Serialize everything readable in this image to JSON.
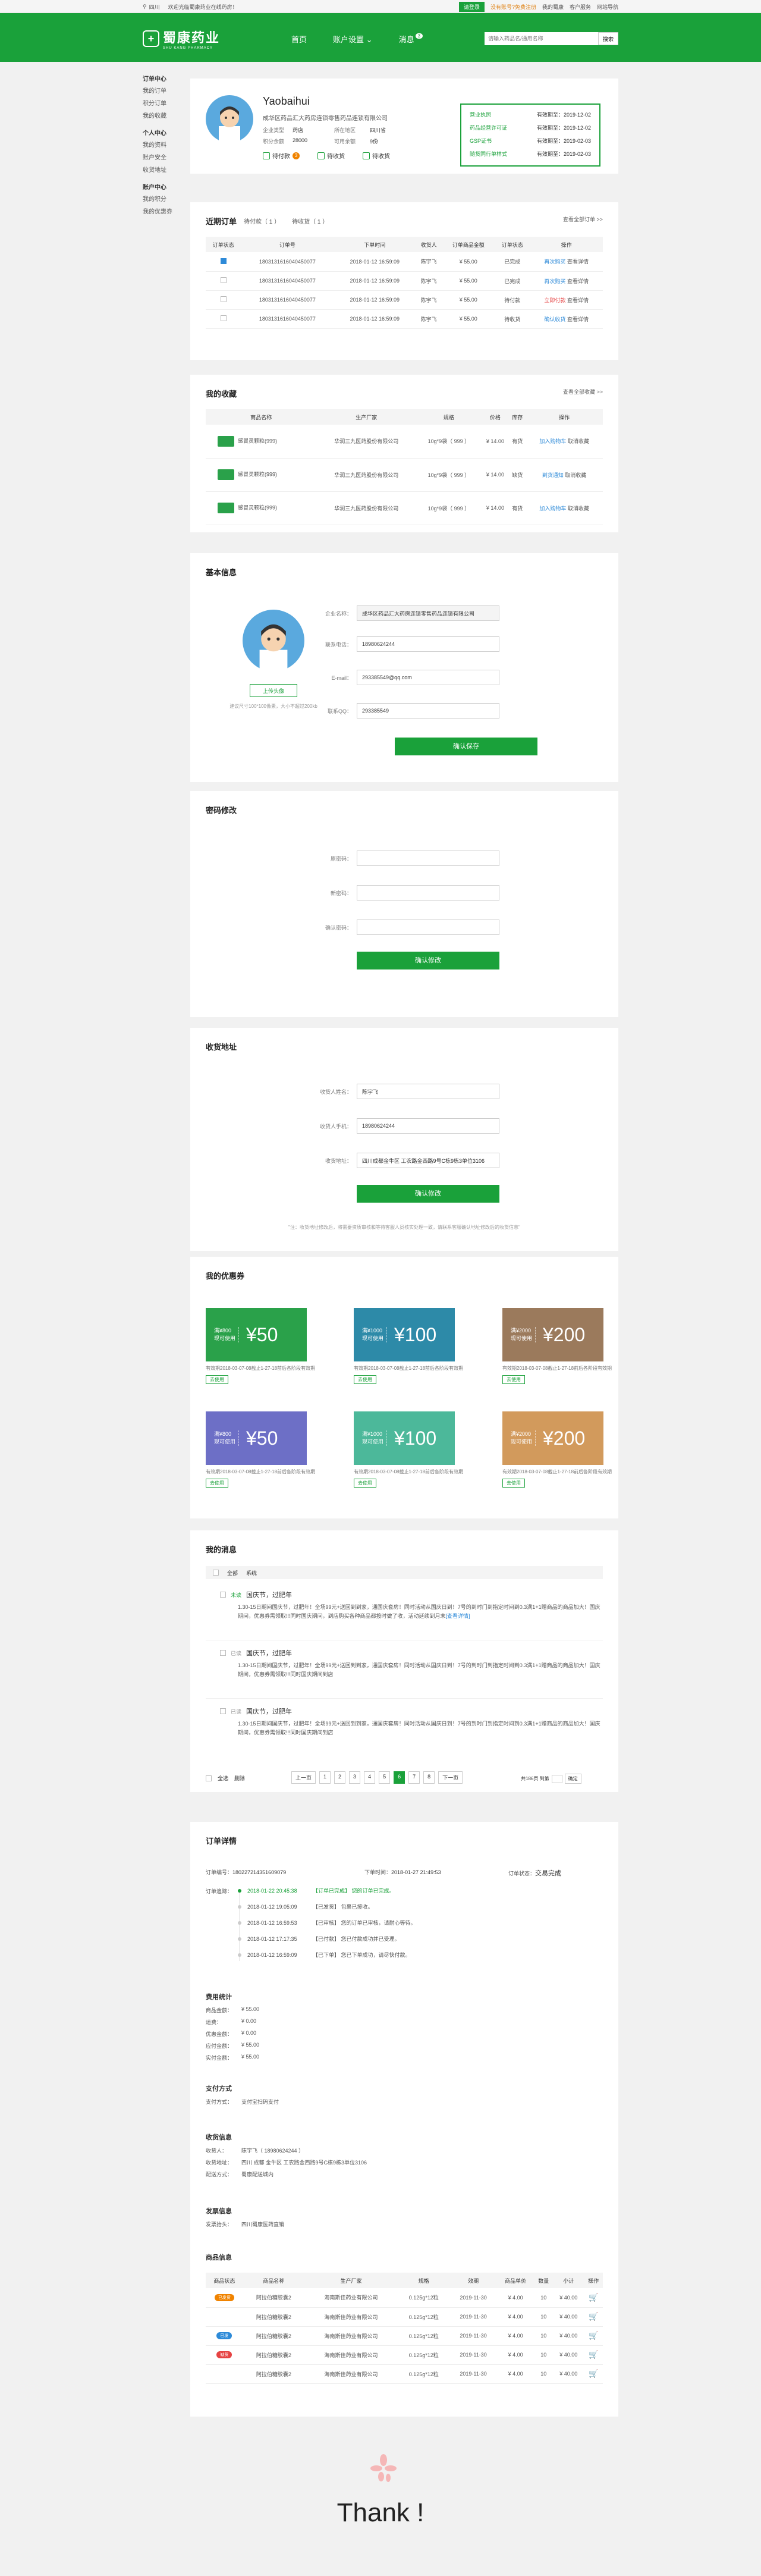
{
  "topbar": {
    "location": "四川",
    "welcome": "欢迎光临蜀康药业在线药房！",
    "login": "请登录",
    "register": "没有账号?免费注册",
    "links": [
      "我的蜀康",
      "客户服务",
      "网站导航"
    ]
  },
  "header": {
    "logo_cn": "蜀康药业",
    "logo_en": "SHU KANG PHARMACY",
    "nav": [
      "首页",
      "账户设置",
      "消息"
    ],
    "msg_badge": "3",
    "search_placeholder": "请输入药品名/通用名称",
    "search_btn": "搜索"
  },
  "sidebar": [
    {
      "title": "订单中心",
      "items": [
        "我的订单",
        "积分订单",
        "我的收藏"
      ]
    },
    {
      "title": "个人中心",
      "items": [
        "我的资料",
        "账户安全",
        "收货地址"
      ]
    },
    {
      "title": "账户中心",
      "items": [
        "我的积分",
        "我的优惠券"
      ]
    }
  ],
  "profile": {
    "name": "Yaobaihui",
    "company": "成华区药品汇大药房连锁零售药品连锁有限公司",
    "fields": [
      [
        "企业类型",
        "药店",
        "所在地区",
        "四川省"
      ],
      [
        "积分余额",
        "28000",
        "可用余额",
        "9份"
      ]
    ],
    "actions": [
      "待付款",
      "待收货",
      "待收货"
    ],
    "pay_badge": "3",
    "stats": [
      [
        "营业执照",
        "有效期至：2019-12-02"
      ],
      [
        "药品经营许可证",
        "有效期至：2019-12-02"
      ],
      [
        "GSP证书",
        "有效期至：2019-02-03"
      ],
      [
        "随货同行单样式",
        "有效期至：2019-02-03"
      ]
    ]
  },
  "recent_orders": {
    "title": "近期订单",
    "tabs": [
      "待付款（ 1 ）",
      "待收货（ 1 ）"
    ],
    "more": "查看全部订单 >>",
    "headers": [
      "订单状态",
      "订单号",
      "下单时间",
      "收货人",
      "订单商品金额",
      "订单状态",
      "操作"
    ],
    "rows": [
      {
        "no": "1803131616040450077",
        "time": "2018-01-12 16:59:09",
        "who": "陈宇飞",
        "amt": "¥ 55.00",
        "status": "已完成",
        "op1": "再次购买",
        "op2": "查看详情"
      },
      {
        "no": "1803131616040450077",
        "time": "2018-01-12 16:59:09",
        "who": "陈宇飞",
        "amt": "¥ 55.00",
        "status": "已完成",
        "op1": "再次购买",
        "op2": "查看详情"
      },
      {
        "no": "1803131616040450077",
        "time": "2018-01-12 16:59:09",
        "who": "陈宇飞",
        "amt": "¥ 55.00",
        "status": "待付款",
        "op1": "立即付款",
        "op2": "查看详情"
      },
      {
        "no": "1803131616040450077",
        "time": "2018-01-12 16:59:09",
        "who": "陈宇飞",
        "amt": "¥ 55.00",
        "status": "待收货",
        "op1": "确认收货",
        "op2": "查看详情"
      }
    ]
  },
  "favorites": {
    "title": "我的收藏",
    "more": "查看全部收藏 >>",
    "headers": [
      "商品名称",
      "生产厂家",
      "规格",
      "价格",
      "库存",
      "操作"
    ],
    "rows": [
      {
        "name": "感冒灵颗粒(999)",
        "maker": "华润三九医药股份有限公司",
        "spec": "10g*9袋（ 999 ）",
        "price": "¥ 14.00",
        "stock": "有货",
        "op1": "加入购物车",
        "op2": "取消收藏"
      },
      {
        "name": "感冒灵颗粒(999)",
        "maker": "华润三九医药股份有限公司",
        "spec": "10g*9袋（ 999 ）",
        "price": "¥ 14.00",
        "stock": "缺货",
        "op1": "到货通知",
        "op2": "取消收藏"
      },
      {
        "name": "感冒灵颗粒(999)",
        "maker": "华润三九医药股份有限公司",
        "spec": "10g*9袋（ 999 ）",
        "price": "¥ 14.00",
        "stock": "有货",
        "op1": "加入购物车",
        "op2": "取消收藏"
      }
    ]
  },
  "basic": {
    "title": "基本信息",
    "upload": "上传头像",
    "tip": "建议尺寸100*100像素，大小不超过200kb",
    "labels": [
      "企业名称：",
      "联系电话：",
      "E-mail：",
      "联系QQ："
    ],
    "values": [
      "成华区药品汇大药房连锁零售药品连锁有限公司",
      "18980624244",
      "293385549@qq.com",
      "293385549"
    ],
    "save": "确认保存"
  },
  "password": {
    "title": "密码修改",
    "labels": [
      "原密码：",
      "新密码：",
      "确认密码："
    ],
    "btn": "确认修改"
  },
  "address": {
    "title": "收货地址",
    "labels": [
      "收货人姓名：",
      "收货人手机：",
      "收货地址："
    ],
    "values": [
      "陈宇飞",
      "18980624244",
      "四川成都金牛区 工农路金西路9号C栋9栋3单位3106"
    ],
    "btn": "确认修改",
    "note": "\"注：收货地址修改后，将需要资质审核和等待客服人员核实处理一致，请联系客服确认地址修改后的收货信息\""
  },
  "coupons": {
    "title": "我的优惠券",
    "items": [
      {
        "cond": "满¥800",
        "type": "现可使用",
        "val": "¥50",
        "color": "#2aa14a"
      },
      {
        "cond": "满¥1000",
        "type": "现可使用",
        "val": "¥100",
        "color": "#2d8aa8"
      },
      {
        "cond": "满¥2000",
        "type": "现可使用",
        "val": "¥200",
        "color": "#9b7a5c"
      },
      {
        "cond": "满¥800",
        "type": "现可使用",
        "val": "¥50",
        "color": "#6d6fc6"
      },
      {
        "cond": "满¥1000",
        "type": "现可使用",
        "val": "¥100",
        "color": "#4cb89a"
      },
      {
        "cond": "满¥2000",
        "type": "现可使用",
        "val": "¥200",
        "color": "#d29a5c"
      }
    ],
    "date": "有效期2018-03-07-08截止1-27-18前后各阶段有效期",
    "use": "去使用"
  },
  "messages": {
    "title": "我的消息",
    "tabs": [
      "全部",
      "系统"
    ],
    "items": [
      {
        "tag": "未读",
        "text": "国庆节，过肥年",
        "body": "1.30-15日期间国庆节，过肥年！全场99元+送回到到家，通国庆套房！同时活动从国庆日到！7号的到时门到指定时间到0.3满1+1赠商品的商品加大！国庆期间，优惠券需领取!!!同时国庆期间，到店购买各种商品都按时做了收，活动延续到月末",
        "link": "[查看详情]"
      },
      {
        "tag": "已读",
        "text": "国庆节，过肥年",
        "body": "1.30-15日期间国庆节，过肥年！全场99元+送回到到家，通国庆套房！同时活动从国庆日到！7号的到时门到指定时间到0.3满1+1赠商品的商品加大！国庆期间，优惠券需领取!!!同时国庆期间到店",
        "link": ""
      },
      {
        "tag": "已读",
        "text": "国庆节，过肥年",
        "body": "1.30-15日期间国庆节，过肥年！全场99元+送回到到家，通国庆套房！同时活动从国庆日到！7号的到时门到指定时间到0.3满1+1赠商品的商品加大！国庆期间，优惠券需领取!!!同时国庆期间到店",
        "link": ""
      }
    ],
    "select_all": "全选",
    "delete": "删除",
    "pages": [
      "上一页",
      "1",
      "2",
      "3",
      "4",
      "5",
      "6",
      "7",
      "8",
      "下一页"
    ],
    "total": "共186页 到第",
    "go": "确定"
  },
  "order_detail": {
    "title": "订单详情",
    "no_label": "订单编号：",
    "no": "180227214351609079",
    "time_label": "下单时间：",
    "time": "2018-01-27 21:49:53",
    "status_label": "订单状态：",
    "status": "交易完成",
    "track_label": "订单追踪：",
    "track": [
      [
        "2018-01-22 20:45:38",
        "【订单已完成】 您的订单已完成。"
      ],
      [
        "2018-01-12 19:05:09",
        "【已发货】 包裹已揽收。"
      ],
      [
        "2018-01-12 16:59:53",
        "【已审核】 您的订单已审核，请耐心等待。"
      ],
      [
        "2018-01-12 17:17:35",
        "【已付款】 您已付款成功并已受理。"
      ],
      [
        "2018-01-12 16:59:09",
        "【已下单】 您已下单成功，请尽快付款。"
      ]
    ],
    "fee_title": "费用统计",
    "fees": [
      [
        "商品金额：",
        "¥ 55.00"
      ],
      [
        "运费：",
        "¥ 0.00"
      ],
      [
        "优惠金额：",
        "¥ 0.00"
      ],
      [
        "应付金额：",
        "¥ 55.00"
      ],
      [
        "实付金额：",
        "¥ 55.00"
      ]
    ],
    "pay_title": "支付方式",
    "pay": [
      [
        "支付方式：",
        "支付宝扫码支付"
      ]
    ],
    "recv_title": "收货信息",
    "recv": [
      [
        "收货人：",
        "陈宇飞（ 18980624244 ）"
      ],
      [
        "收货地址：",
        "四川 成都 金牛区 工农路金西路9号C栋9栋3单位3106"
      ],
      [
        "配送方式：",
        "蜀康配送城内"
      ]
    ],
    "inv_title": "发票信息",
    "inv": [
      [
        "发票抬头：",
        "四川蜀康医药直销"
      ]
    ],
    "goods_title": "商品信息",
    "goods_headers": [
      "商品状态",
      "商品名称",
      "生产厂家",
      "规格",
      "效期",
      "商品单价",
      "数量",
      "小计",
      "操作"
    ],
    "goods": [
      {
        "tag": "已发货",
        "tagc": "#f08300",
        "name": "阿拉伯糖胶囊2",
        "maker": "海南斯佳药业有限公司",
        "spec": "0.125g*12粒",
        "exp": "2019-11-30",
        "price": "¥ 4.00",
        "qty": "10",
        "sub": "¥ 40.00"
      },
      {
        "tag": "",
        "tagc": "",
        "name": "阿拉伯糖胶囊2",
        "maker": "海南斯佳药业有限公司",
        "spec": "0.125g*12粒",
        "exp": "2019-11-30",
        "price": "¥ 4.00",
        "qty": "10",
        "sub": "¥ 40.00"
      },
      {
        "tag": "已发",
        "tagc": "#2d8ad8",
        "name": "阿拉伯糖胶囊2",
        "maker": "海南斯佳药业有限公司",
        "spec": "0.125g*12粒",
        "exp": "2019-11-30",
        "price": "¥ 4.00",
        "qty": "10",
        "sub": "¥ 40.00"
      },
      {
        "tag": "缺货",
        "tagc": "#e64343",
        "name": "阿拉伯糖胶囊2",
        "maker": "海南斯佳药业有限公司",
        "spec": "0.125g*12粒",
        "exp": "2019-11-30",
        "price": "¥ 4.00",
        "qty": "10",
        "sub": "¥ 40.00"
      },
      {
        "tag": "",
        "tagc": "",
        "name": "阿拉伯糖胶囊2",
        "maker": "海南斯佳药业有限公司",
        "spec": "0.125g*12粒",
        "exp": "2019-11-30",
        "price": "¥ 4.00",
        "qty": "10",
        "sub": "¥ 40.00"
      }
    ]
  },
  "thanks": "Thank !"
}
